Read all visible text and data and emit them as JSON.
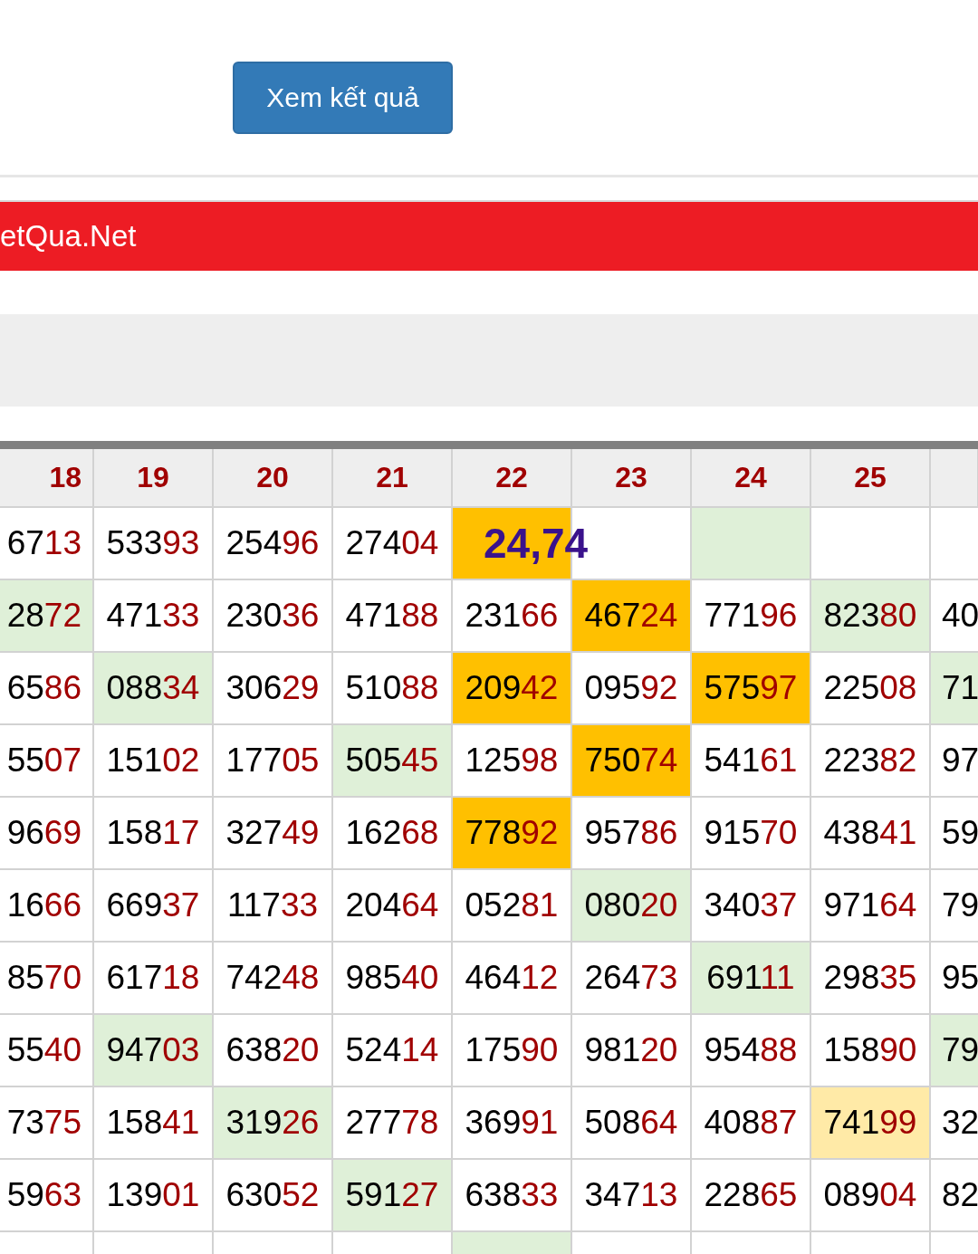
{
  "search_form": {
    "submit_button": "Xem kết quả"
  },
  "banner": {
    "title": "etQua.Net"
  },
  "table": {
    "columns": [
      "18",
      "19",
      "20",
      "21",
      "22",
      "23",
      "24",
      "25"
    ],
    "rows": [
      {
        "cells": [
          {
            "lead": "67",
            "tail": "13",
            "color": "#ffffff"
          },
          {
            "lead": "533",
            "tail": "93",
            "color": "#ffffff"
          },
          {
            "lead": "254",
            "tail": "96",
            "color": "#ffffff"
          },
          {
            "lead": "274",
            "tail": "04",
            "color": "#ffffff"
          },
          {
            "kind": "special",
            "text": "24,74",
            "color": "#ffc000"
          },
          {
            "color": "#ffffff"
          },
          {
            "color": "#dff0d8"
          },
          {
            "color": "#ffffff"
          },
          {
            "color": "#ffffff"
          }
        ]
      },
      {
        "cells": [
          {
            "lead": "28",
            "tail": "72",
            "color": "#dff0d8"
          },
          {
            "lead": "471",
            "tail": "33",
            "color": "#ffffff"
          },
          {
            "lead": "230",
            "tail": "36",
            "color": "#ffffff"
          },
          {
            "lead": "471",
            "tail": "88",
            "color": "#ffffff"
          },
          {
            "lead": "231",
            "tail": "66",
            "color": "#ffffff"
          },
          {
            "lead": "467",
            "tail": "24",
            "color": "#ffc000"
          },
          {
            "lead": "771",
            "tail": "96",
            "color": "#ffffff"
          },
          {
            "lead": "823",
            "tail": "80",
            "color": "#dff0d8"
          },
          {
            "lead": "40",
            "color": "#ffffff"
          }
        ]
      },
      {
        "cells": [
          {
            "lead": "65",
            "tail": "86",
            "color": "#ffffff"
          },
          {
            "lead": "088",
            "tail": "34",
            "color": "#dff0d8"
          },
          {
            "lead": "306",
            "tail": "29",
            "color": "#ffffff"
          },
          {
            "lead": "510",
            "tail": "88",
            "color": "#ffffff"
          },
          {
            "lead": "209",
            "tail": "42",
            "color": "#ffc000"
          },
          {
            "lead": "095",
            "tail": "92",
            "color": "#ffffff"
          },
          {
            "lead": "575",
            "tail": "97",
            "color": "#ffc000"
          },
          {
            "lead": "225",
            "tail": "08",
            "color": "#ffffff"
          },
          {
            "lead": "71",
            "color": "#dff0d8"
          }
        ]
      },
      {
        "cells": [
          {
            "lead": "55",
            "tail": "07",
            "color": "#ffffff"
          },
          {
            "lead": "151",
            "tail": "02",
            "color": "#ffffff"
          },
          {
            "lead": "177",
            "tail": "05",
            "color": "#ffffff"
          },
          {
            "lead": "505",
            "tail": "45",
            "color": "#dff0d8"
          },
          {
            "lead": "125",
            "tail": "98",
            "color": "#ffffff"
          },
          {
            "lead": "750",
            "tail": "74",
            "color": "#ffc000"
          },
          {
            "lead": "541",
            "tail": "61",
            "color": "#ffffff"
          },
          {
            "lead": "223",
            "tail": "82",
            "color": "#ffffff"
          },
          {
            "lead": "97",
            "color": "#ffffff"
          }
        ]
      },
      {
        "cells": [
          {
            "lead": "96",
            "tail": "69",
            "color": "#ffffff"
          },
          {
            "lead": "158",
            "tail": "17",
            "color": "#ffffff"
          },
          {
            "lead": "327",
            "tail": "49",
            "color": "#ffffff"
          },
          {
            "lead": "162",
            "tail": "68",
            "color": "#ffffff"
          },
          {
            "lead": "778",
            "tail": "92",
            "color": "#ffc000"
          },
          {
            "lead": "957",
            "tail": "86",
            "color": "#ffffff"
          },
          {
            "lead": "915",
            "tail": "70",
            "color": "#ffffff"
          },
          {
            "lead": "438",
            "tail": "41",
            "color": "#ffffff"
          },
          {
            "lead": "59",
            "color": "#ffffff"
          }
        ]
      },
      {
        "cells": [
          {
            "lead": "16",
            "tail": "66",
            "color": "#ffffff"
          },
          {
            "lead": "669",
            "tail": "37",
            "color": "#ffffff"
          },
          {
            "lead": "117",
            "tail": "33",
            "color": "#ffffff"
          },
          {
            "lead": "204",
            "tail": "64",
            "color": "#ffffff"
          },
          {
            "lead": "052",
            "tail": "81",
            "color": "#ffffff"
          },
          {
            "lead": "080",
            "tail": "20",
            "color": "#dff0d8"
          },
          {
            "lead": "340",
            "tail": "37",
            "color": "#ffffff"
          },
          {
            "lead": "971",
            "tail": "64",
            "color": "#ffffff"
          },
          {
            "lead": "79",
            "color": "#ffffff"
          }
        ]
      },
      {
        "cells": [
          {
            "lead": "85",
            "tail": "70",
            "color": "#ffffff"
          },
          {
            "lead": "617",
            "tail": "18",
            "color": "#ffffff"
          },
          {
            "lead": "742",
            "tail": "48",
            "color": "#ffffff"
          },
          {
            "lead": "985",
            "tail": "40",
            "color": "#ffffff"
          },
          {
            "lead": "464",
            "tail": "12",
            "color": "#ffffff"
          },
          {
            "lead": "264",
            "tail": "73",
            "color": "#ffffff"
          },
          {
            "lead": "691",
            "tail": "11",
            "color": "#dff0d8"
          },
          {
            "lead": "298",
            "tail": "35",
            "color": "#ffffff"
          },
          {
            "lead": "95",
            "color": "#ffffff"
          }
        ]
      },
      {
        "cells": [
          {
            "lead": "55",
            "tail": "40",
            "color": "#ffffff"
          },
          {
            "lead": "947",
            "tail": "03",
            "color": "#dff0d8"
          },
          {
            "lead": "638",
            "tail": "20",
            "color": "#ffffff"
          },
          {
            "lead": "524",
            "tail": "14",
            "color": "#ffffff"
          },
          {
            "lead": "175",
            "tail": "90",
            "color": "#ffffff"
          },
          {
            "lead": "981",
            "tail": "20",
            "color": "#ffffff"
          },
          {
            "lead": "954",
            "tail": "88",
            "color": "#ffffff"
          },
          {
            "lead": "158",
            "tail": "90",
            "color": "#ffffff"
          },
          {
            "lead": "79",
            "color": "#dff0d8"
          }
        ]
      },
      {
        "cells": [
          {
            "lead": "73",
            "tail": "75",
            "color": "#ffffff"
          },
          {
            "lead": "158",
            "tail": "41",
            "color": "#ffffff"
          },
          {
            "lead": "319",
            "tail": "26",
            "color": "#dff0d8"
          },
          {
            "lead": "277",
            "tail": "78",
            "color": "#ffffff"
          },
          {
            "lead": "369",
            "tail": "91",
            "color": "#ffffff"
          },
          {
            "lead": "508",
            "tail": "64",
            "color": "#ffffff"
          },
          {
            "lead": "408",
            "tail": "87",
            "color": "#ffffff"
          },
          {
            "lead": "741",
            "tail": "99",
            "color": "#ffeaa7"
          },
          {
            "lead": "32",
            "color": "#ffffff"
          }
        ]
      },
      {
        "cells": [
          {
            "lead": "59",
            "tail": "63",
            "color": "#ffffff"
          },
          {
            "lead": "139",
            "tail": "01",
            "color": "#ffffff"
          },
          {
            "lead": "630",
            "tail": "52",
            "color": "#ffffff"
          },
          {
            "lead": "591",
            "tail": "27",
            "color": "#dff0d8"
          },
          {
            "lead": "638",
            "tail": "33",
            "color": "#ffffff"
          },
          {
            "lead": "347",
            "tail": "13",
            "color": "#ffffff"
          },
          {
            "lead": "228",
            "tail": "65",
            "color": "#ffffff"
          },
          {
            "lead": "089",
            "tail": "04",
            "color": "#ffffff"
          },
          {
            "lead": "82",
            "color": "#ffffff"
          }
        ]
      },
      {
        "cells": [
          {
            "color": "#ffffff"
          },
          {
            "color": "#ffffff"
          },
          {
            "color": "#ffffff"
          },
          {
            "color": "#ffffff"
          },
          {
            "color": "#dff0d8"
          },
          {
            "color": "#ffffff"
          },
          {
            "color": "#ffffff"
          },
          {
            "color": "#ffffff"
          },
          {
            "color": "#ffffff"
          }
        ]
      }
    ]
  }
}
